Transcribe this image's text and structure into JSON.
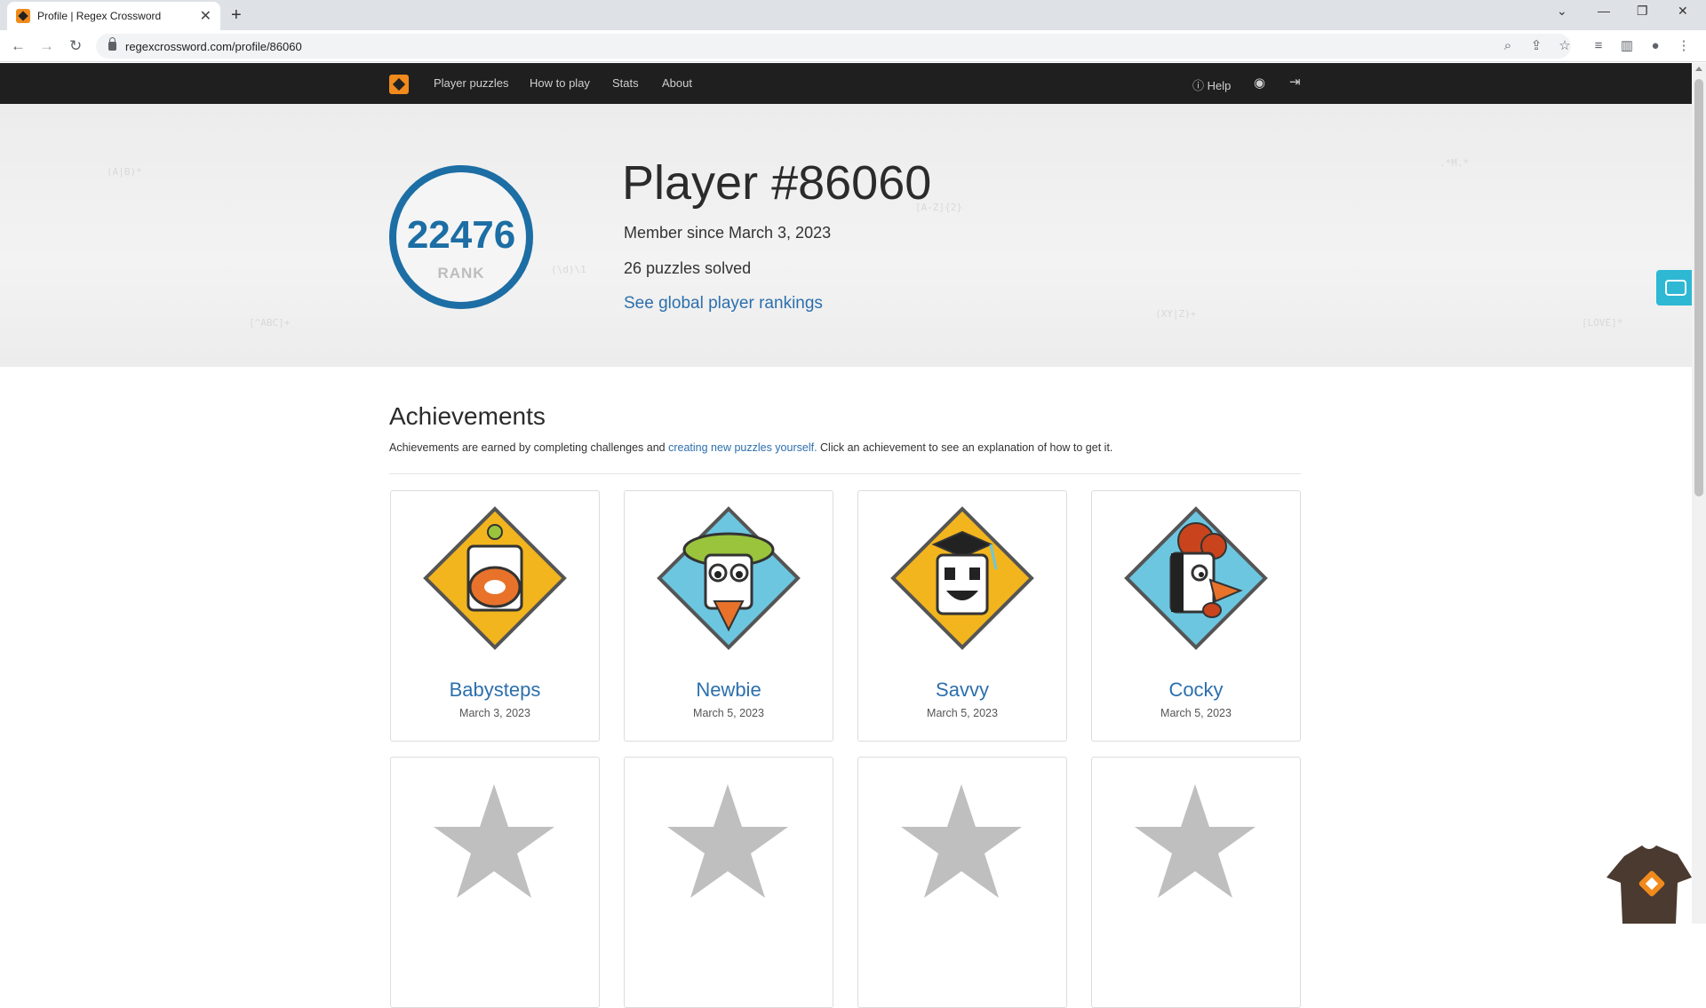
{
  "browser": {
    "tab_title": "Profile | Regex Crossword",
    "url": "regexcrossword.com/profile/86060",
    "new_tab": "+",
    "close_tab": "✕"
  },
  "nav": {
    "items": [
      "Player puzzles",
      "How to play",
      "Stats",
      "About"
    ],
    "help": "Help"
  },
  "profile": {
    "rank": "22476",
    "rank_label": "RANK",
    "player_title": "Player #86060",
    "member_since": "Member since March 3, 2023",
    "puzzles_solved": "26 puzzles solved",
    "rankings_link": "See global player rankings"
  },
  "achievements": {
    "title": "Achievements",
    "desc_before": "Achievements are earned by completing challenges and ",
    "desc_link": "creating new puzzles yourself.",
    "desc_after": " Click an achievement to see an explanation of how to get it.",
    "earned": [
      {
        "name": "Babysteps",
        "date": "March 3, 2023",
        "bg": "#f2b51e",
        "face": "#e8722a"
      },
      {
        "name": "Newbie",
        "date": "March 5, 2023",
        "bg": "#6cc6e0",
        "face": "#9ac43c"
      },
      {
        "name": "Savvy",
        "date": "March 5, 2023",
        "bg": "#f2b51e",
        "face": "#222222"
      },
      {
        "name": "Cocky",
        "date": "March 5, 2023",
        "bg": "#6cc6e0",
        "face": "#e8722a"
      }
    ],
    "locked_count_visible": 4,
    "locked_icon": "star-icon"
  },
  "colors": {
    "accent": "#1c6ea4",
    "link": "#2c6fad",
    "navbar": "#1f1f1f",
    "brand": "#f08a1c",
    "star_locked": "#bfbfbf"
  }
}
